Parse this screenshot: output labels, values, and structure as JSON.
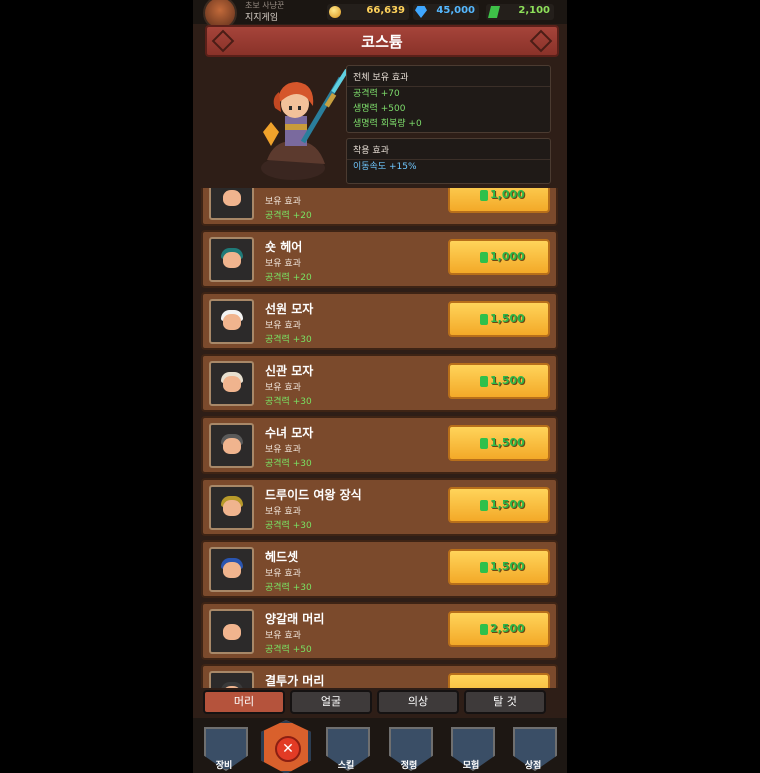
{
  "player": {
    "rank": "초보 사냥꾼",
    "name": "지지게임"
  },
  "currency": {
    "gold": "66,639",
    "gems": "45,000",
    "jade": "2,100"
  },
  "screen": {
    "title": "코스튬"
  },
  "preview": {
    "owned_header": "전체 보유 효과",
    "owned_effects": [
      "공격력 +70",
      "생명력 +500",
      "생명력 회복량 +0"
    ],
    "equip_header": "착용 효과",
    "equip_effects": [
      "이동속도 +15%"
    ]
  },
  "items": [
    {
      "name": "",
      "effect_label": "보유 효과",
      "effect": "공격력 +20",
      "price": "1,000",
      "hair": "#2a2a2a"
    },
    {
      "name": "숏 헤어",
      "effect_label": "보유 효과",
      "effect": "공격력 +20",
      "price": "1,000",
      "hair": "#1f7a78"
    },
    {
      "name": "선원 모자",
      "effect_label": "보유 효과",
      "effect": "공격력 +30",
      "price": "1,500",
      "hair": "#f3f3f3"
    },
    {
      "name": "신관 모자",
      "effect_label": "보유 효과",
      "effect": "공격력 +30",
      "price": "1,500",
      "hair": "#e8e0d0"
    },
    {
      "name": "수녀 모자",
      "effect_label": "보유 효과",
      "effect": "공격력 +30",
      "price": "1,500",
      "hair": "#5a5a5a"
    },
    {
      "name": "드루이드 여왕 장식",
      "effect_label": "보유 효과",
      "effect": "공격력 +30",
      "price": "1,500",
      "hair": "#b89a2a"
    },
    {
      "name": "헤드셋",
      "effect_label": "보유 효과",
      "effect": "공격력 +30",
      "price": "1,500",
      "hair": "#2a55b0"
    },
    {
      "name": "양갈래 머리",
      "effect_label": "보유 효과",
      "effect": "공격력 +50",
      "price": "2,500",
      "hair": "#2b2b2b"
    },
    {
      "name": "결투가 머리",
      "effect_label": "",
      "effect": "",
      "price": "",
      "hair": "#3a3a3a"
    }
  ],
  "tabs": [
    "머리",
    "얼굴",
    "의상",
    "탈 것"
  ],
  "active_tab": "머리",
  "nav": [
    {
      "label": "장비",
      "icon": "sword-icon"
    },
    {
      "label": "스킬",
      "icon": "spellbook-icon"
    },
    {
      "label": "정령",
      "icon": "spirit-flame-icon"
    },
    {
      "label": "모험",
      "icon": "compass-icon"
    },
    {
      "label": "상점",
      "icon": "treasure-chest-icon"
    }
  ],
  "nav_center": {
    "icon": "close-icon"
  },
  "colors": {
    "price_green": "#2cb84a",
    "effect_green": "#7ae062",
    "header_red": "#a6443a",
    "active_tab": "#b5533c"
  }
}
